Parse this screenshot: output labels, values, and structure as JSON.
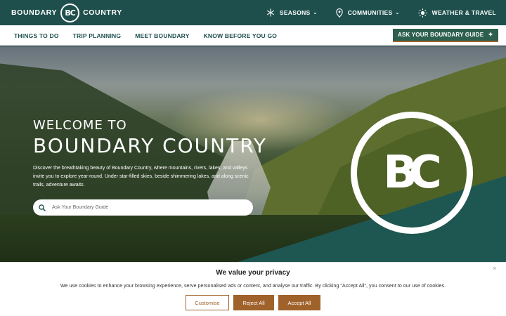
{
  "brand": {
    "left": "BOUNDARY",
    "logo": "BC",
    "right": "COUNTRY"
  },
  "topnav": {
    "items": [
      {
        "label": "SEASONS",
        "icon": "snowflake-icon",
        "has_dropdown": true
      },
      {
        "label": "COMMUNITIES",
        "icon": "location-pin-icon",
        "has_dropdown": true
      },
      {
        "label": "WEATHER & TRAVEL",
        "icon": "sun-icon",
        "has_dropdown": false
      }
    ]
  },
  "mainnav": {
    "links": [
      "THINGS TO DO",
      "TRIP PLANNING",
      "MEET BOUNDARY",
      "KNOW BEFORE YOU GO"
    ],
    "guide_button": "ASK YOUR BOUNDARY GUIDE"
  },
  "hero": {
    "welcome_small": "WELCOME TO",
    "welcome_big": "BOUNDARY COUNTRY",
    "description": "Discover the breathtaking beauty of Boundary Country, where mountains, rivers, lakes, and valleys invite you to explore year-round. Under star-filled skies, beside shimmering lakes, and along scenic trails, adventure awaits.",
    "search_placeholder": "Ask Your Boundary Guide",
    "badge": "BC"
  },
  "cookie": {
    "title": "We value your privacy",
    "text": "We use cookies to enhance your browsing experience, serve personalised ads or content, and analyse our traffic. By clicking \"Accept All\", you consent to our use of cookies.",
    "customise": "Customise",
    "reject": "Reject All",
    "accept": "Accept All",
    "close": "×"
  },
  "colors": {
    "teal": "#1e4f4d",
    "accent": "#a0622b",
    "guide_button_bg": "#2d5f4f"
  }
}
